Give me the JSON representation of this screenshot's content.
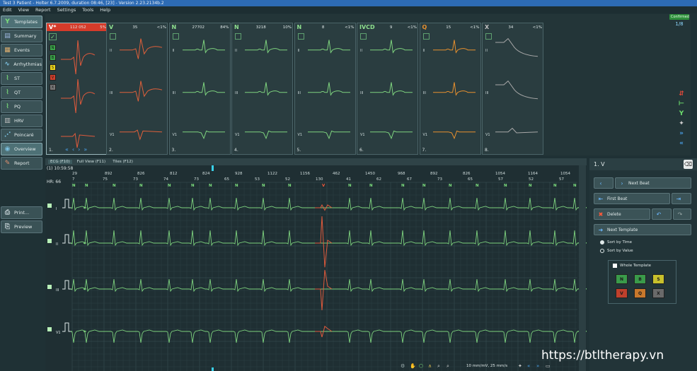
{
  "window": {
    "title": "Test 3 Patient - Holter 6.7.2009, duration 08:46, [23] - Version 2.23.2134b.2"
  },
  "menu": [
    "Edit",
    "View",
    "Report",
    "Settings",
    "Tools",
    "Help"
  ],
  "sidebar": {
    "items": [
      {
        "label": "Templates",
        "icon": "Y",
        "color": "#7ce07c",
        "selected": true
      },
      {
        "label": "Summary",
        "icon": "▤",
        "color": "#9fb8e0",
        "selected": false
      },
      {
        "label": "Events",
        "icon": "▦",
        "color": "#e0b070",
        "selected": false
      },
      {
        "label": "Arrhythmias",
        "icon": "∿",
        "color": "#7cc0e0",
        "selected": false
      },
      {
        "label": "ST",
        "icon": "⌇",
        "color": "#7ce07c",
        "selected": false
      },
      {
        "label": "QT",
        "icon": "⌇",
        "color": "#7ce07c",
        "selected": false
      },
      {
        "label": "PQ",
        "icon": "⌇",
        "color": "#7ce07c",
        "selected": false
      },
      {
        "label": "HRV",
        "icon": "▥",
        "color": "#c0c0c0",
        "selected": false
      },
      {
        "label": "Poincaré",
        "icon": "⋰",
        "color": "#7cc0e0",
        "selected": false
      },
      {
        "label": "Overview",
        "icon": "◉",
        "color": "#7cc0e0",
        "selected": true
      },
      {
        "label": "Report",
        "icon": "✎",
        "color": "#e09070",
        "selected": false
      }
    ],
    "bottom": [
      {
        "label": "Print...",
        "icon": "⎙"
      },
      {
        "label": "Preview",
        "icon": "⎘"
      }
    ]
  },
  "templates": [
    {
      "num": "1.",
      "type": "V*",
      "count": "112 052",
      "pct": "5%",
      "color": "#e05a3c",
      "header_bg": "#d63b2a",
      "leads": [],
      "selected": true
    },
    {
      "num": "2.",
      "type": "V",
      "count": "35",
      "pct": "<1%",
      "color": "#e0603a",
      "header_bg": "",
      "leads": [
        "II",
        "III",
        "V1"
      ]
    },
    {
      "num": "3.",
      "type": "N",
      "count": "27702",
      "pct": "84%",
      "color": "#7ed37e",
      "header_bg": "",
      "leads": [
        "II",
        "III",
        "V1"
      ]
    },
    {
      "num": "4.",
      "type": "N",
      "count": "3218",
      "pct": "10%",
      "color": "#7ed37e",
      "header_bg": "",
      "leads": [
        "II",
        "III",
        "V1"
      ]
    },
    {
      "num": "5.",
      "type": "N",
      "count": "8",
      "pct": "<1%",
      "color": "#7ed37e",
      "header_bg": "",
      "leads": [
        "II",
        "III",
        "V1"
      ]
    },
    {
      "num": "6.",
      "type": "IVCD",
      "count": "9",
      "pct": "<1%",
      "color": "#7ed37e",
      "header_bg": "",
      "leads": [
        "II",
        "III",
        "V1"
      ]
    },
    {
      "num": "7.",
      "type": "Q",
      "count": "15",
      "pct": "<1%",
      "color": "#e8902e",
      "header_bg": "",
      "leads": [
        "II",
        "III",
        "V1"
      ]
    },
    {
      "num": "8.",
      "type": "X",
      "count": "34",
      "pct": "<1%",
      "color": "#a8a8a8",
      "header_bg": "",
      "leads": [
        "II",
        "III",
        "V1"
      ]
    }
  ],
  "template_classes": [
    {
      "label": "N",
      "bg": "#3aa34a"
    },
    {
      "label": "B",
      "bg": "#3aa34a"
    },
    {
      "label": "S",
      "bg": "#e8d21c"
    },
    {
      "label": "V",
      "bg": "#d0402c"
    },
    {
      "label": "X",
      "bg": "#777777"
    }
  ],
  "counter": {
    "badge": "Confirmed",
    "value": "1/8"
  },
  "right_icons": [
    {
      "name": "split-icon",
      "glyph": "⇵",
      "color": "#e04a3a"
    },
    {
      "name": "merge-icon",
      "glyph": "⊢",
      "color": "#6ee06e"
    },
    {
      "name": "template-icon",
      "glyph": "Y",
      "color": "#6ee06e"
    },
    {
      "name": "tools-icon",
      "glyph": "✦",
      "color": "#d0d0d0"
    },
    {
      "name": "expand-icon",
      "glyph": "»",
      "color": "#4aa0e8"
    },
    {
      "name": "collapse-icon",
      "glyph": "«",
      "color": "#4aa0e8"
    }
  ],
  "ecg": {
    "tabs": [
      "ECG (F10)",
      "Full View (F11)",
      "Tiles (F12)"
    ],
    "timestamp": "(1) 10:59:58",
    "hr": "HR: 66",
    "rr_top": [
      "29",
      "892",
      "826",
      "812",
      "824",
      "928",
      "1122",
      "1156",
      "462",
      "1450",
      "968",
      "892",
      "826",
      "1054",
      "1164",
      "1054"
    ],
    "rr_bottom": [
      "7",
      "75",
      "73",
      "74",
      "73",
      "65",
      "53",
      "52",
      "130",
      "41",
      "62",
      "67",
      "73",
      "65",
      "57",
      "52",
      "57"
    ],
    "beat_labels": [
      "N",
      "N",
      "N",
      "N",
      "N",
      "N",
      "N",
      "N",
      "N",
      "N",
      "V",
      "N",
      "N",
      "N",
      "N",
      "N",
      "N",
      "N",
      "N",
      "N",
      "N"
    ],
    "leads": [
      "I",
      "II",
      "III",
      "V1"
    ],
    "scale": "10 mm/mV, 25 mm/s"
  },
  "right_panel": {
    "title": "1. V",
    "next_beat": "Next Beat",
    "first_beat": "First Beat",
    "delete": "Delete",
    "next_template": "Next Template",
    "sort_time": "Sort by Time",
    "sort_value": "Sort by Value",
    "whole_template": "Whole Template",
    "class_buttons": [
      {
        "label": "N",
        "bg": "#3a9b4a"
      },
      {
        "label": "B",
        "bg": "#3a9b4a"
      },
      {
        "label": "S",
        "bg": "#c8c02c"
      },
      {
        "label": "V",
        "bg": "#c0402c"
      },
      {
        "label": "Q",
        "bg": "#c8782c"
      },
      {
        "label": "X",
        "bg": "#6a6a6a"
      }
    ]
  },
  "watermark": "https://btltherapy.vn"
}
